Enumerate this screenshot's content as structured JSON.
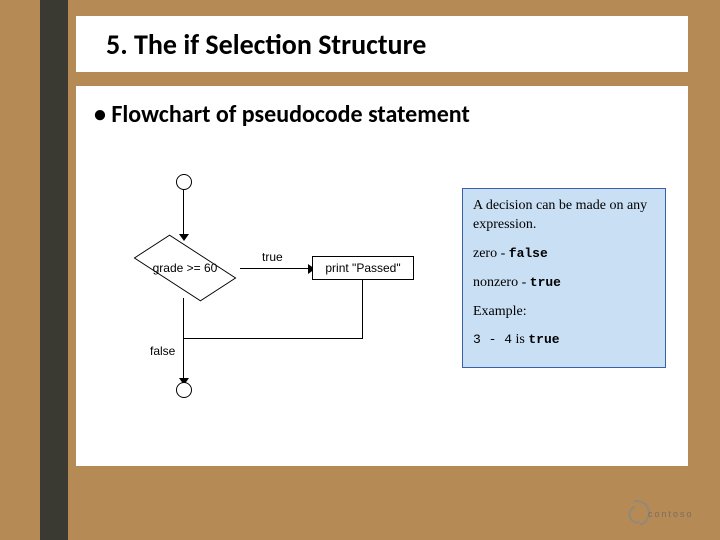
{
  "title": "5.  The if Selection Structure",
  "bullet": "• Flowchart of pseudocode statement",
  "flowchart": {
    "condition": "grade >= 60",
    "true_label": "true",
    "false_label": "false",
    "action": "print \"Passed\""
  },
  "info": {
    "line1": "A decision can be made on any expression.",
    "zero_word": "zero",
    "dash1": " - ",
    "false_word": "false",
    "nonzero_word": "nonzero",
    "dash2": " - ",
    "true_word": "true",
    "example_label": "Example:",
    "example_expr": "3 - 4",
    "example_is": " is ",
    "example_result": "true"
  },
  "logo_text": "contoso"
}
